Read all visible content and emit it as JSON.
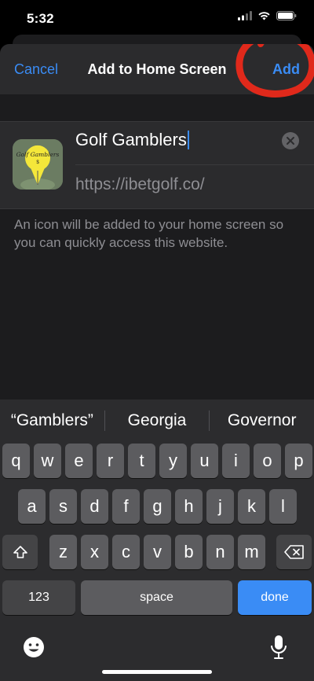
{
  "status": {
    "time": "5:32"
  },
  "nav": {
    "cancel": "Cancel",
    "title": "Add to Home Screen",
    "add": "Add"
  },
  "shortcut": {
    "name": "Golf Gamblers",
    "url": "https://ibetgolf.co/",
    "icon_text": "Golf Gamblers",
    "icon_sub": "$"
  },
  "description": "An icon will be added to your home screen so you can quickly access this website.",
  "keyboard": {
    "suggestions": [
      "“Gamblers”",
      "Georgia",
      "Governor"
    ],
    "row1": [
      "q",
      "w",
      "e",
      "r",
      "t",
      "y",
      "u",
      "i",
      "o",
      "p"
    ],
    "row2": [
      "a",
      "s",
      "d",
      "f",
      "g",
      "h",
      "j",
      "k",
      "l"
    ],
    "row3": [
      "z",
      "x",
      "c",
      "v",
      "b",
      "n",
      "m"
    ],
    "numbers": "123",
    "space": "space",
    "done": "done"
  },
  "colors": {
    "accent": "#3a8cf5",
    "annotation": "#e0291b",
    "background": "#1c1c1e"
  }
}
